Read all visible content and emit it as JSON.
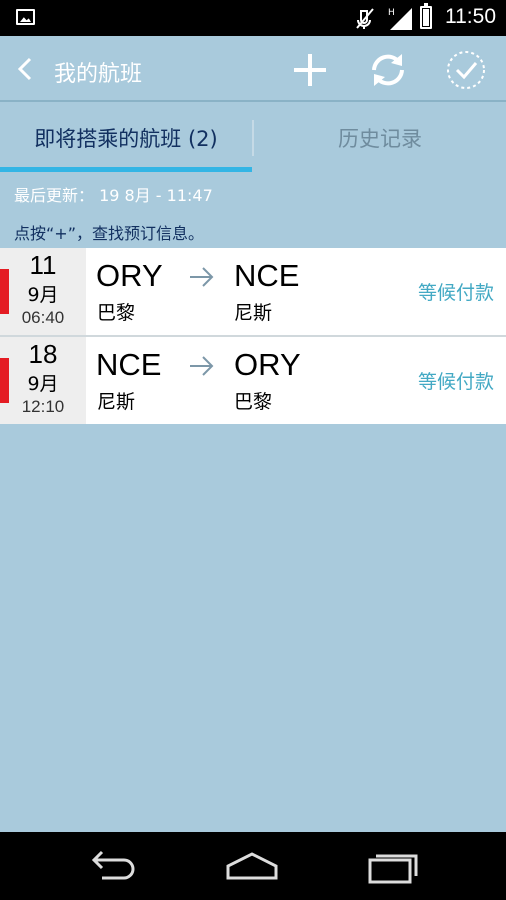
{
  "status_bar": {
    "time": "11:50",
    "icons": [
      "image-notification-icon",
      "mute-icon",
      "signal-icon",
      "battery-icon"
    ]
  },
  "app_bar": {
    "title": "我的航班",
    "actions": [
      "add-icon",
      "sync-icon",
      "check-all-icon"
    ]
  },
  "tabs": [
    {
      "label": "即将搭乘的航班 (2)",
      "active": true
    },
    {
      "label": "历史记录",
      "active": false
    }
  ],
  "info": {
    "last_updated": "最后更新： 19 8月 - 11:47",
    "hint": "点按“+”，查找预订信息。"
  },
  "flights": [
    {
      "day": "11",
      "month": "9月",
      "time": "06:40",
      "from_code": "ORY",
      "from_city": "巴黎",
      "to_code": "NCE",
      "to_city": "尼斯",
      "status": "等候付款"
    },
    {
      "day": "18",
      "month": "9月",
      "time": "12:10",
      "from_code": "NCE",
      "from_city": "尼斯",
      "to_code": "ORY",
      "to_city": "巴黎",
      "status": "等候付款"
    }
  ],
  "colors": {
    "background": "#a9cadc",
    "accent": "#33b5e5",
    "status_text": "#43a9c4",
    "marker_red": "#e41c23"
  }
}
